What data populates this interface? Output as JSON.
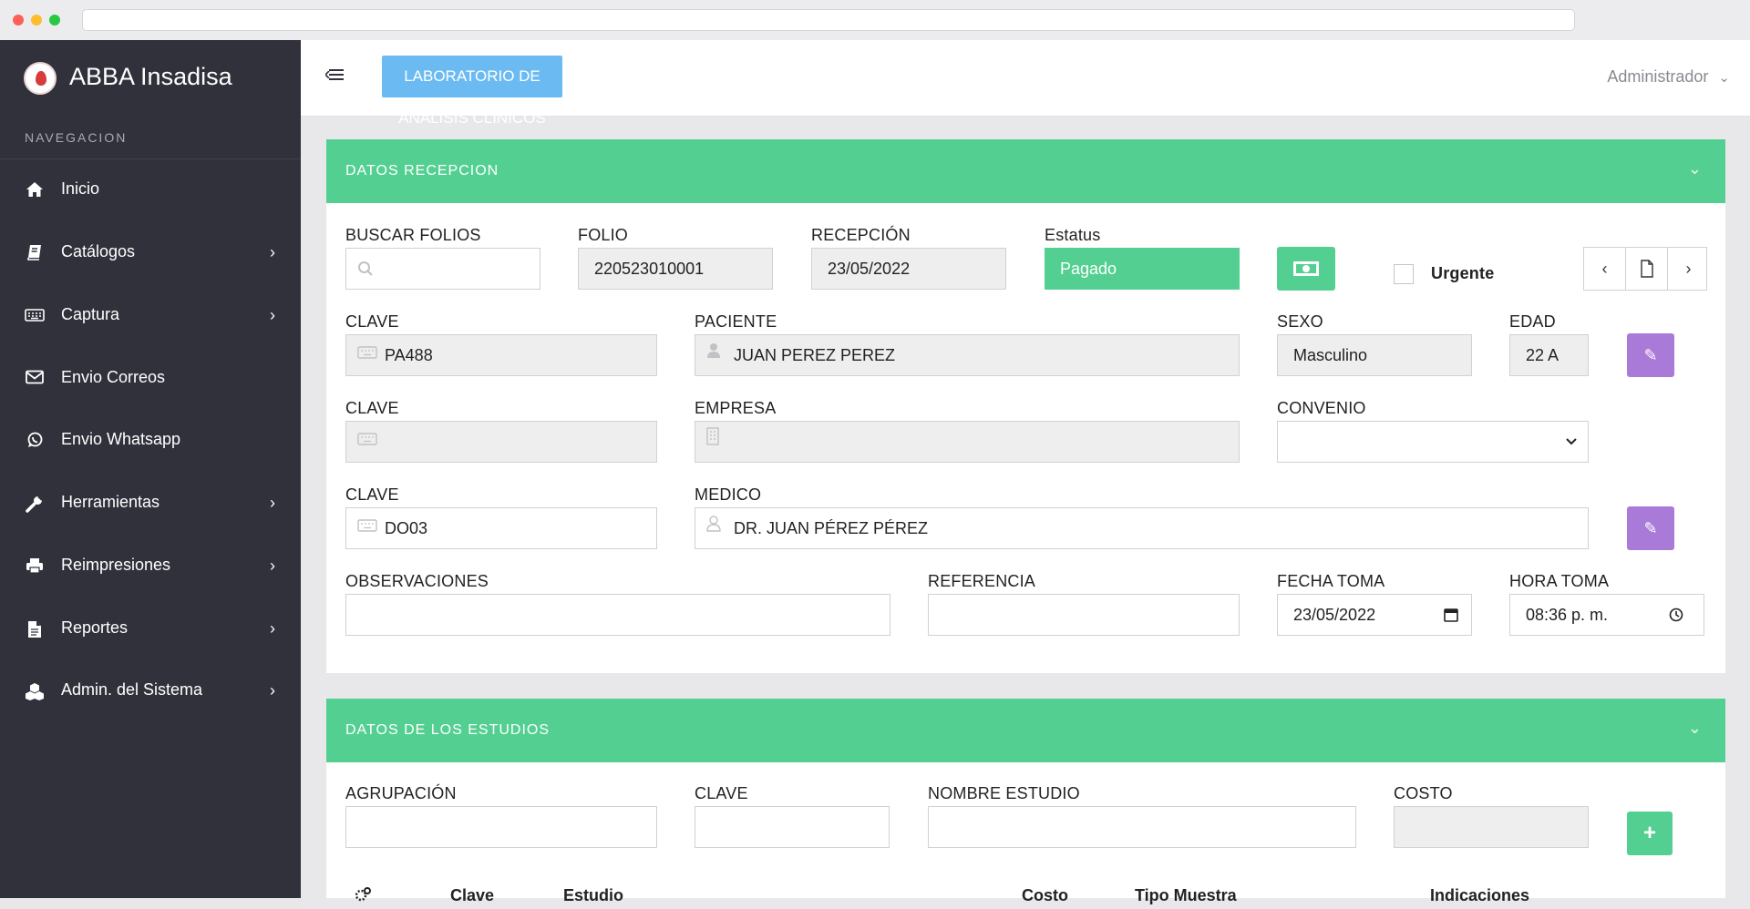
{
  "sidebar": {
    "brand": "ABBA Insadisa",
    "nav_title": "NAVEGACION",
    "items": [
      {
        "label": "Inicio",
        "icon": "home-icon",
        "has_children": false
      },
      {
        "label": "Catálogos",
        "icon": "book-icon",
        "has_children": true
      },
      {
        "label": "Captura",
        "icon": "keyboard-icon",
        "has_children": true
      },
      {
        "label": "Envio Correos",
        "icon": "envelope-icon",
        "has_children": false
      },
      {
        "label": "Envio Whatsapp",
        "icon": "whatsapp-icon",
        "has_children": false
      },
      {
        "label": "Herramientas",
        "icon": "wrench-icon",
        "has_children": true
      },
      {
        "label": "Reimpresiones",
        "icon": "printer-icon",
        "has_children": true
      },
      {
        "label": "Reportes",
        "icon": "document-icon",
        "has_children": true
      },
      {
        "label": "Admin. del Sistema",
        "icon": "cubes-icon",
        "has_children": true
      }
    ]
  },
  "header": {
    "lab_button": "LABORATORIO DE ANÁLISIS CLÍNICOS",
    "user": "Administrador"
  },
  "recepcion": {
    "title": "DATOS RECEPCION",
    "buscar_folios_label": "BUSCAR FOLIOS",
    "buscar_folios_value": "",
    "folio_label": "FOLIO",
    "folio_value": "220523010001",
    "recepcion_label": "RECEPCIÓN",
    "recepcion_value": "23/05/2022",
    "estatus_label": "Estatus",
    "estatus_value": "Pagado",
    "urgente_label": "Urgente",
    "clave_label": "CLAVE",
    "paciente_clave": "PA488",
    "paciente_label": "PACIENTE",
    "paciente_value": "JUAN PEREZ PEREZ",
    "sexo_label": "SEXO",
    "sexo_value": "Masculino",
    "edad_label": "EDAD",
    "edad_value": "22 A",
    "empresa_clave": "",
    "empresa_label": "EMPRESA",
    "empresa_value": "",
    "convenio_label": "CONVENIO",
    "convenio_value": "",
    "medico_clave": "DO03",
    "medico_label": "MEDICO",
    "medico_value": "DR. JUAN PÉREZ PÉREZ",
    "observaciones_label": "OBSERVACIONES",
    "observaciones_value": "",
    "referencia_label": "REFERENCIA",
    "referencia_value": "",
    "fecha_toma_label": "FECHA TOMA",
    "fecha_toma_value": "23/05/2022",
    "hora_toma_label": "HORA TOMA",
    "hora_toma_value": "08:36 p. m."
  },
  "estudios": {
    "title": "DATOS DE LOS ESTUDIOS",
    "agrupacion_label": "AGRUPACIÓN",
    "clave_label": "CLAVE",
    "nombre_label": "NOMBRE ESTUDIO",
    "costo_label": "COSTO",
    "table_headers": [
      "Clave",
      "Estudio",
      "Costo",
      "Tipo Muestra",
      "Indicaciones"
    ]
  },
  "colors": {
    "sidebar_bg": "#30313b",
    "accent_green": "#53d091",
    "accent_blue": "#6bbbf2",
    "accent_purple": "#a97ad8"
  }
}
